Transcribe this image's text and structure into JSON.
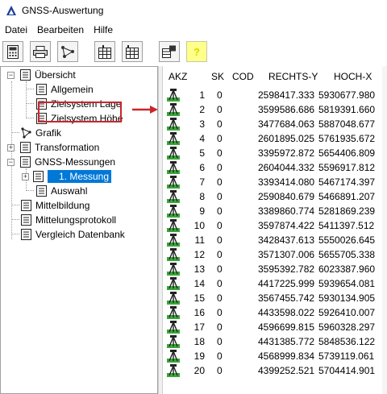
{
  "window": {
    "title": "GNSS-Auswertung"
  },
  "menu": [
    "Datei",
    "Bearbeiten",
    "Hilfe"
  ],
  "toolbar": {
    "buttons": [
      {
        "icon": "calculator-icon"
      },
      {
        "icon": "printer-icon"
      },
      {
        "icon": "network-graph-icon"
      },
      {
        "icon": "table-calc-icon"
      },
      {
        "icon": "table-calc-alt-icon"
      },
      {
        "icon": "transfer-icon"
      },
      {
        "icon": "help-icon",
        "label": "?"
      }
    ]
  },
  "tree": {
    "uebersicht": "Übersicht",
    "allgemein": "Allgemein",
    "zielsystem_lage": "Zielsystem Lage",
    "zielsystem_hoehe": "Zielsystem Höhe",
    "grafik": "Grafik",
    "transformation": "Transformation",
    "gnss_messungen": "GNSS-Messungen",
    "messung": "1. Messung",
    "auswahl": "Auswahl",
    "mittelbildung": "Mittelbildung",
    "mittelungsprotokoll": "Mittelungsprotokoll",
    "vergleich": "Vergleich Datenbank",
    "expander_minus": "−",
    "expander_plus": "+"
  },
  "grid": {
    "headers": {
      "akz": "AKZ",
      "sk": "SK",
      "cod": "COD",
      "rechts": "RECHTS-Y",
      "hoch": "HOCH-X"
    },
    "rows": [
      {
        "nr": "1",
        "sk": "0",
        "rechts": "2598417.333",
        "hoch": "5930677.980"
      },
      {
        "nr": "2",
        "sk": "0",
        "rechts": "3599586.686",
        "hoch": "5819391.660"
      },
      {
        "nr": "3",
        "sk": "0",
        "rechts": "3477684.063",
        "hoch": "5887048.677"
      },
      {
        "nr": "4",
        "sk": "0",
        "rechts": "2601895.025",
        "hoch": "5761935.672"
      },
      {
        "nr": "5",
        "sk": "0",
        "rechts": "3395972.872",
        "hoch": "5654406.809"
      },
      {
        "nr": "6",
        "sk": "0",
        "rechts": "2604044.332",
        "hoch": "5596917.812"
      },
      {
        "nr": "7",
        "sk": "0",
        "rechts": "3393414.080",
        "hoch": "5467174.397"
      },
      {
        "nr": "8",
        "sk": "0",
        "rechts": "2590840.679",
        "hoch": "5466891.207"
      },
      {
        "nr": "9",
        "sk": "0",
        "rechts": "3389860.774",
        "hoch": "5281869.239"
      },
      {
        "nr": "10",
        "sk": "0",
        "rechts": "3597874.422",
        "hoch": "5411397.512"
      },
      {
        "nr": "11",
        "sk": "0",
        "rechts": "3428437.613",
        "hoch": "5550026.645"
      },
      {
        "nr": "12",
        "sk": "0",
        "rechts": "3571307.006",
        "hoch": "5655705.338"
      },
      {
        "nr": "13",
        "sk": "0",
        "rechts": "3595392.782",
        "hoch": "6023387.960"
      },
      {
        "nr": "14",
        "sk": "0",
        "rechts": "4417225.999",
        "hoch": "5939654.081"
      },
      {
        "nr": "15",
        "sk": "0",
        "rechts": "3567455.742",
        "hoch": "5930134.905"
      },
      {
        "nr": "16",
        "sk": "0",
        "rechts": "4433598.022",
        "hoch": "5926410.007"
      },
      {
        "nr": "17",
        "sk": "0",
        "rechts": "4596699.815",
        "hoch": "5960328.297"
      },
      {
        "nr": "18",
        "sk": "0",
        "rechts": "4431385.772",
        "hoch": "5848536.122"
      },
      {
        "nr": "19",
        "sk": "0",
        "rechts": "4568999.834",
        "hoch": "5739119.061"
      },
      {
        "nr": "20",
        "sk": "0",
        "rechts": "4399252.521",
        "hoch": "5704414.901"
      }
    ]
  },
  "colors": {
    "selection": "#0078d7",
    "highlight_box": "#c8262b",
    "arrow": "#c8262b",
    "help_button": "#ffff8c"
  }
}
